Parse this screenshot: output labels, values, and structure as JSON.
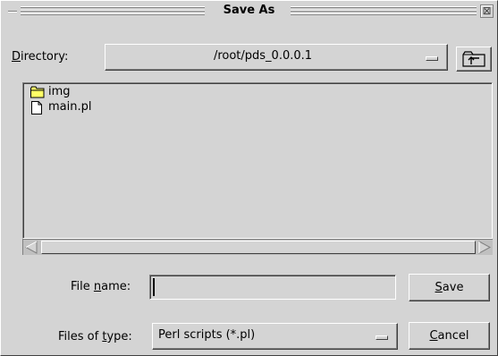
{
  "window": {
    "title": "Save As",
    "close_glyph": "⊠"
  },
  "directory": {
    "label_prefix": "D",
    "label_rest": "irectory:",
    "value": "/root/pds_0.0.0.1",
    "up_icon": "folder-up-icon"
  },
  "files": [
    {
      "name": "img",
      "icon": "folder-icon"
    },
    {
      "name": "main.pl",
      "icon": "file-icon"
    }
  ],
  "filename": {
    "label_pre": "File ",
    "label_ul": "n",
    "label_post": "ame:",
    "value": ""
  },
  "filetype": {
    "label_pre": "Files of ",
    "label_ul": "t",
    "label_post": "ype:",
    "value": "Perl scripts (*.pl)"
  },
  "buttons": {
    "save_ul": "S",
    "save_rest": "ave",
    "cancel_ul": "C",
    "cancel_rest": "ancel"
  }
}
